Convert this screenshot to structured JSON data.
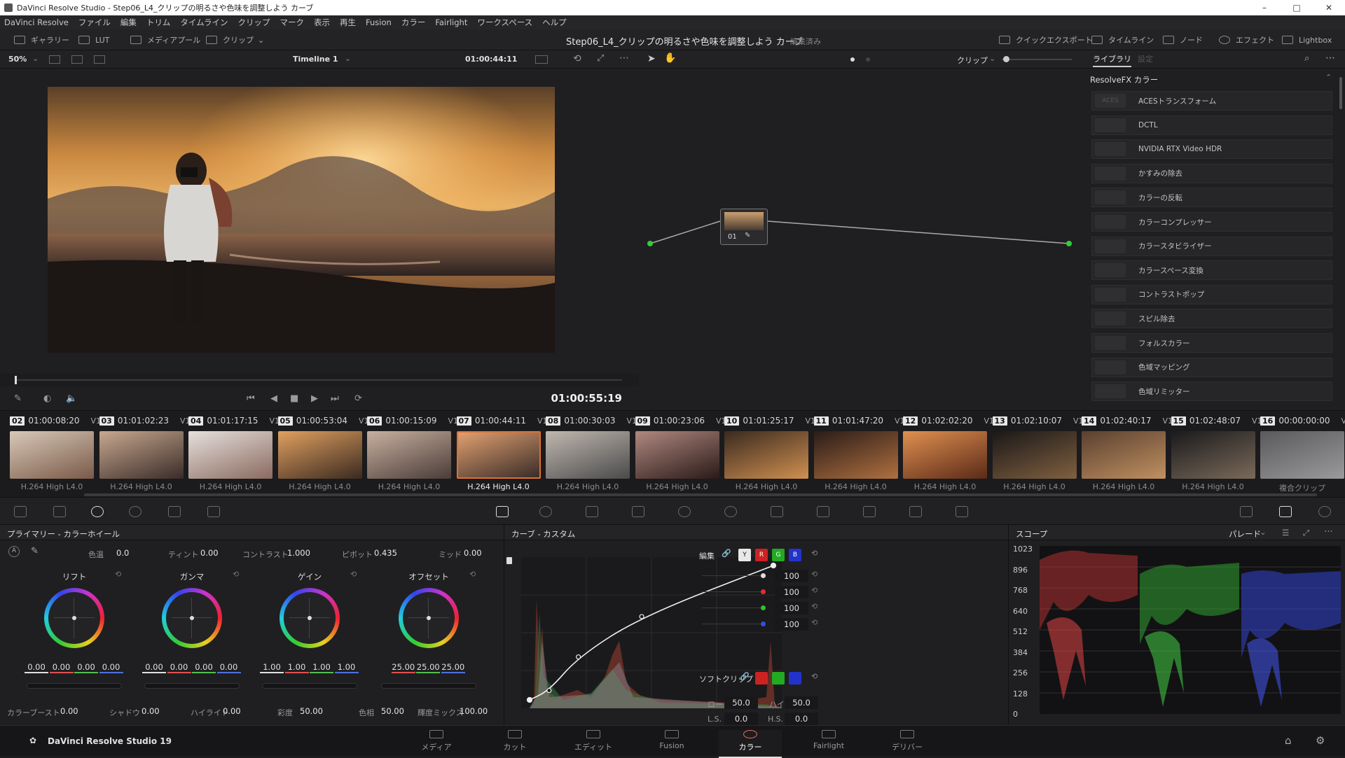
{
  "window": {
    "title": "DaVinci Resolve Studio - Step06_L4_クリップの明るさや色味を調整しよう カーブ"
  },
  "menu": [
    "DaVinci Resolve",
    "ファイル",
    "編集",
    "トリム",
    "タイムライン",
    "クリップ",
    "マーク",
    "表示",
    "再生",
    "Fusion",
    "カラー",
    "Fairlight",
    "ワークスペース",
    "ヘルプ"
  ],
  "toolbar": {
    "gallery": "ギャラリー",
    "lut": "LUT",
    "media_pool": "メディアプール",
    "clip": "クリップ",
    "project_title": "Step06_L4_クリップの明るさや色味を調整しよう カーブ",
    "project_status": "編集済み",
    "quick_export": "クイックエクスポート",
    "timeline": "タイムライン",
    "nodes": "ノード",
    "effects": "エフェクト",
    "lightbox": "Lightbox"
  },
  "viewer": {
    "zoom": "50%",
    "timeline_name": "Timeline 1",
    "source_tc": "01:00:44:11",
    "playhead_tc": "01:00:55:19",
    "progress": 0.0
  },
  "node_editor": {
    "mode": "クリップ",
    "node_label": "01"
  },
  "library": {
    "tab_library": "ライブラリ",
    "tab_settings": "設定",
    "section": "ResolveFX カラー",
    "items": [
      "ACESトランスフォーム",
      "DCTL",
      "NVIDIA RTX Video HDR",
      "かすみの除去",
      "カラーの反転",
      "カラーコンプレッサー",
      "カラースタビライザー",
      "カラースペース変換",
      "コントラストポップ",
      "スピル除去",
      "フォルスカラー",
      "色域マッピング",
      "色域リミッター"
    ],
    "thumb_text": "ACES"
  },
  "clips": [
    {
      "num": "02",
      "tc": "01:00:08:20",
      "track": "V1",
      "codec": "H.264 High L4.0"
    },
    {
      "num": "03",
      "tc": "01:01:02:23",
      "track": "V1",
      "codec": "H.264 High L4.0"
    },
    {
      "num": "04",
      "tc": "01:01:17:15",
      "track": "V1",
      "codec": "H.264 High L4.0"
    },
    {
      "num": "05",
      "tc": "01:00:53:04",
      "track": "V1",
      "codec": "H.264 High L4.0"
    },
    {
      "num": "06",
      "tc": "01:00:15:09",
      "track": "V1",
      "codec": "H.264 High L4.0"
    },
    {
      "num": "07",
      "tc": "01:00:44:11",
      "track": "V1",
      "codec": "H.264 High L4.0"
    },
    {
      "num": "08",
      "tc": "01:00:30:03",
      "track": "V1",
      "codec": "H.264 High L4.0"
    },
    {
      "num": "09",
      "tc": "01:00:23:06",
      "track": "V1",
      "codec": "H.264 High L4.0"
    },
    {
      "num": "10",
      "tc": "01:01:25:17",
      "track": "V1",
      "codec": "H.264 High L4.0"
    },
    {
      "num": "11",
      "tc": "01:01:47:20",
      "track": "V1",
      "codec": "H.264 High L4.0"
    },
    {
      "num": "12",
      "tc": "01:02:02:20",
      "track": "V1",
      "codec": "H.264 High L4.0"
    },
    {
      "num": "13",
      "tc": "01:02:10:07",
      "track": "V1",
      "codec": "H.264 High L4.0"
    },
    {
      "num": "14",
      "tc": "01:02:40:17",
      "track": "V1",
      "codec": "H.264 High L4.0"
    },
    {
      "num": "15",
      "tc": "01:02:48:07",
      "track": "V1",
      "codec": "H.264 High L4.0"
    },
    {
      "num": "16",
      "tc": "00:00:00:00",
      "track": "V1",
      "codec": "複合クリップ"
    }
  ],
  "primary": {
    "title": "プライマリー - カラーホイール",
    "temp_label": "色温",
    "temp": "0.0",
    "tint_label": "ティント",
    "tint": "0.00",
    "contrast_label": "コントラスト",
    "contrast": "1.000",
    "pivot_label": "ピボット",
    "pivot": "0.435",
    "mid_label": "ミッド",
    "mid": "0.00",
    "wheels": [
      {
        "name": "リフト",
        "vals": [
          "0.00",
          "0.00",
          "0.00",
          "0.00"
        ]
      },
      {
        "name": "ガンマ",
        "vals": [
          "0.00",
          "0.00",
          "0.00",
          "0.00"
        ]
      },
      {
        "name": "ゲイン",
        "vals": [
          "1.00",
          "1.00",
          "1.00",
          "1.00"
        ]
      },
      {
        "name": "オフセット",
        "vals": [
          "25.00",
          "25.00",
          "25.00"
        ]
      }
    ],
    "boost_label": "カラーブースト",
    "boost": "0.00",
    "shadow_label": "シャドウ",
    "shadow": "0.00",
    "highlight_label": "ハイライト",
    "highlight": "0.00",
    "sat_label": "彩度",
    "sat": "50.00",
    "hue_label": "色相",
    "hue": "50.00",
    "lummix_label": "輝度ミックス",
    "lummix": "100.00"
  },
  "curves": {
    "title": "カーブ - カスタム",
    "edit_label": "編集",
    "y": "Y",
    "r": "R",
    "g": "G",
    "b": "B",
    "intensity": [
      "100",
      "100",
      "100",
      "100"
    ],
    "softclip_label": "ソフトクリップ",
    "low_label": "ロー",
    "low": "50.0",
    "high_label": "ハイ",
    "high": "50.0",
    "ls_label": "L.S.",
    "ls": "0.0",
    "hs_label": "H.S.",
    "hs": "0.0",
    "points": [
      [
        0,
        0
      ],
      [
        0.08,
        0.07
      ],
      [
        0.2,
        0.32
      ],
      [
        0.46,
        0.62
      ],
      [
        1,
        1
      ]
    ]
  },
  "scopes": {
    "title": "スコープ",
    "mode": "パレード",
    "ticks": [
      "1023",
      "896",
      "768",
      "640",
      "512",
      "384",
      "256",
      "128",
      "0"
    ]
  },
  "footer": {
    "app": "DaVinci Resolve Studio 19",
    "pages": [
      "メディア",
      "カット",
      "エディット",
      "Fusion",
      "カラー",
      "Fairlight",
      "デリバー"
    ],
    "active": "カラー"
  }
}
